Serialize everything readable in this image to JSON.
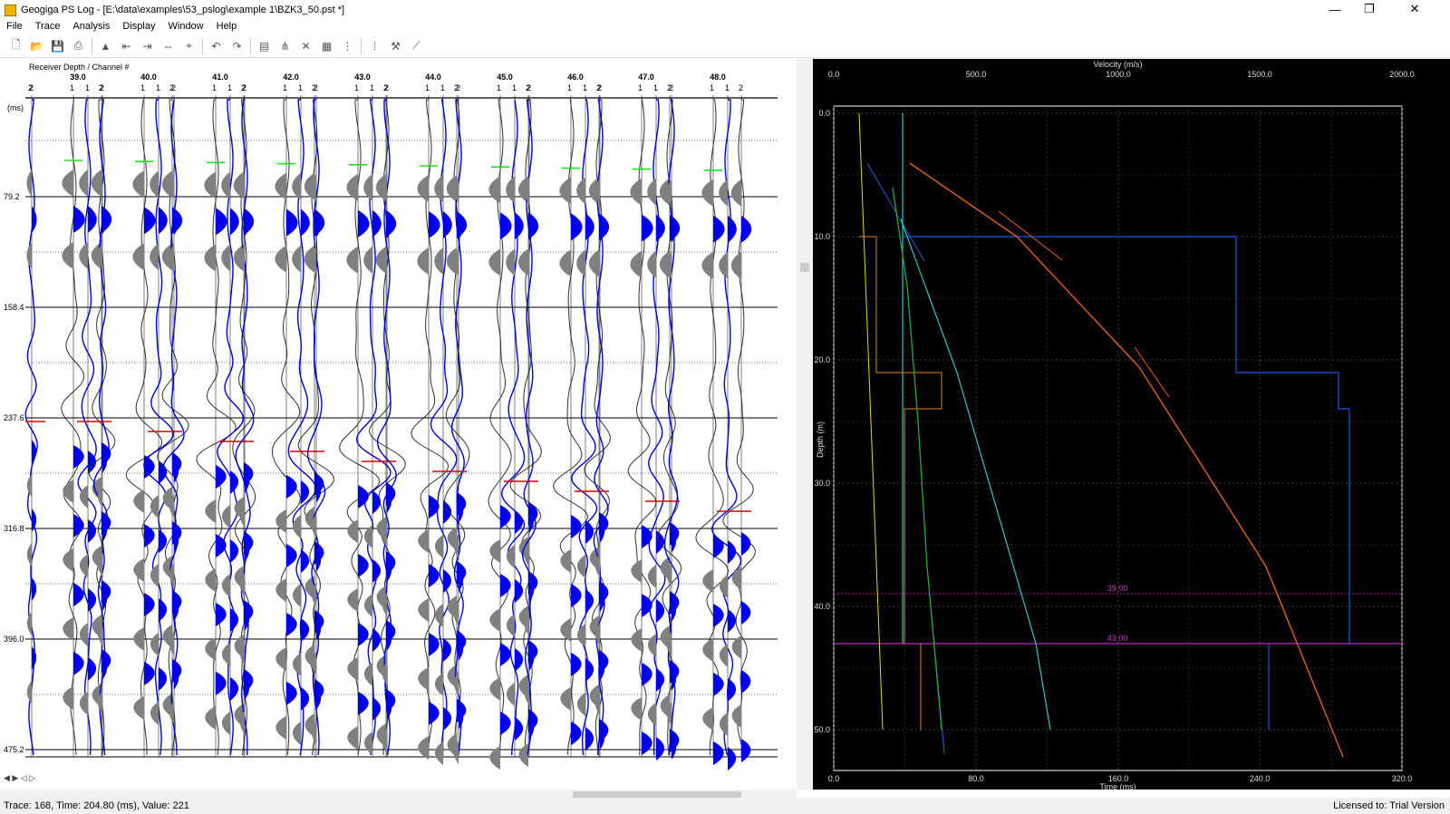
{
  "window": {
    "title": "Geogiga PS Log - [E:\\data\\examples\\53_pslog\\example 1\\BZK3_50.pst *]",
    "minimize": "—",
    "maximize": "❐",
    "close": "✕"
  },
  "menu": [
    "File",
    "Trace",
    "Analysis",
    "Display",
    "Window",
    "Help"
  ],
  "toolbar": {
    "icons": [
      "new-icon",
      "open-icon",
      "save-icon",
      "print-icon",
      "pick-icon",
      "shift-left-icon",
      "shift-right-icon",
      "shift-both-icon",
      "select-icon",
      "undo-icon",
      "redo-icon",
      "ruler-icon",
      "fit-icon",
      "cross-icon",
      "table-icon",
      "gain-icon",
      "filter-icon",
      "tools-icon",
      "velocity-icon"
    ]
  },
  "seismic": {
    "header_label": "Receiver Depth / Channel #",
    "units": "(ms)",
    "time_labels": [
      "79.2",
      "158.4",
      "237.6",
      "316.8",
      "396.0",
      "475.2"
    ],
    "depths": [
      "39.0",
      "40.0",
      "41.0",
      "42.0",
      "43.0",
      "44.0",
      "45.0",
      "46.0",
      "47.0",
      "48.0"
    ],
    "channels": [
      "1",
      "1",
      "2"
    ],
    "first_channel": "2"
  },
  "plot": {
    "velocity_title": "Velocity (m/s)",
    "velocity_ticks": [
      "0.0",
      "500.0",
      "1000.0",
      "1500.0",
      "2000.0"
    ],
    "depth_label": "Depth (m)",
    "depth_ticks": [
      "0.0",
      "10.0",
      "20.0",
      "30.0",
      "40.0",
      "50.0"
    ],
    "time_label": "Time (ms)",
    "time_ticks": [
      "0.0",
      "80.0",
      "160.0",
      "240.0",
      "320.0"
    ],
    "markers": [
      "39.00",
      "43.00"
    ],
    "colors": {
      "marker": "#a020a0",
      "vp": "#1e5ad8",
      "vs": "#e86010",
      "vs_model": "#e08020",
      "time_s": "#30c8c8",
      "time_p": "#20b020",
      "yellow": "#e0e000"
    }
  },
  "status": {
    "text": "Trace: 168, Time: 204.80 (ms), Value: 221",
    "license": "Licensed to: Trial Version"
  }
}
